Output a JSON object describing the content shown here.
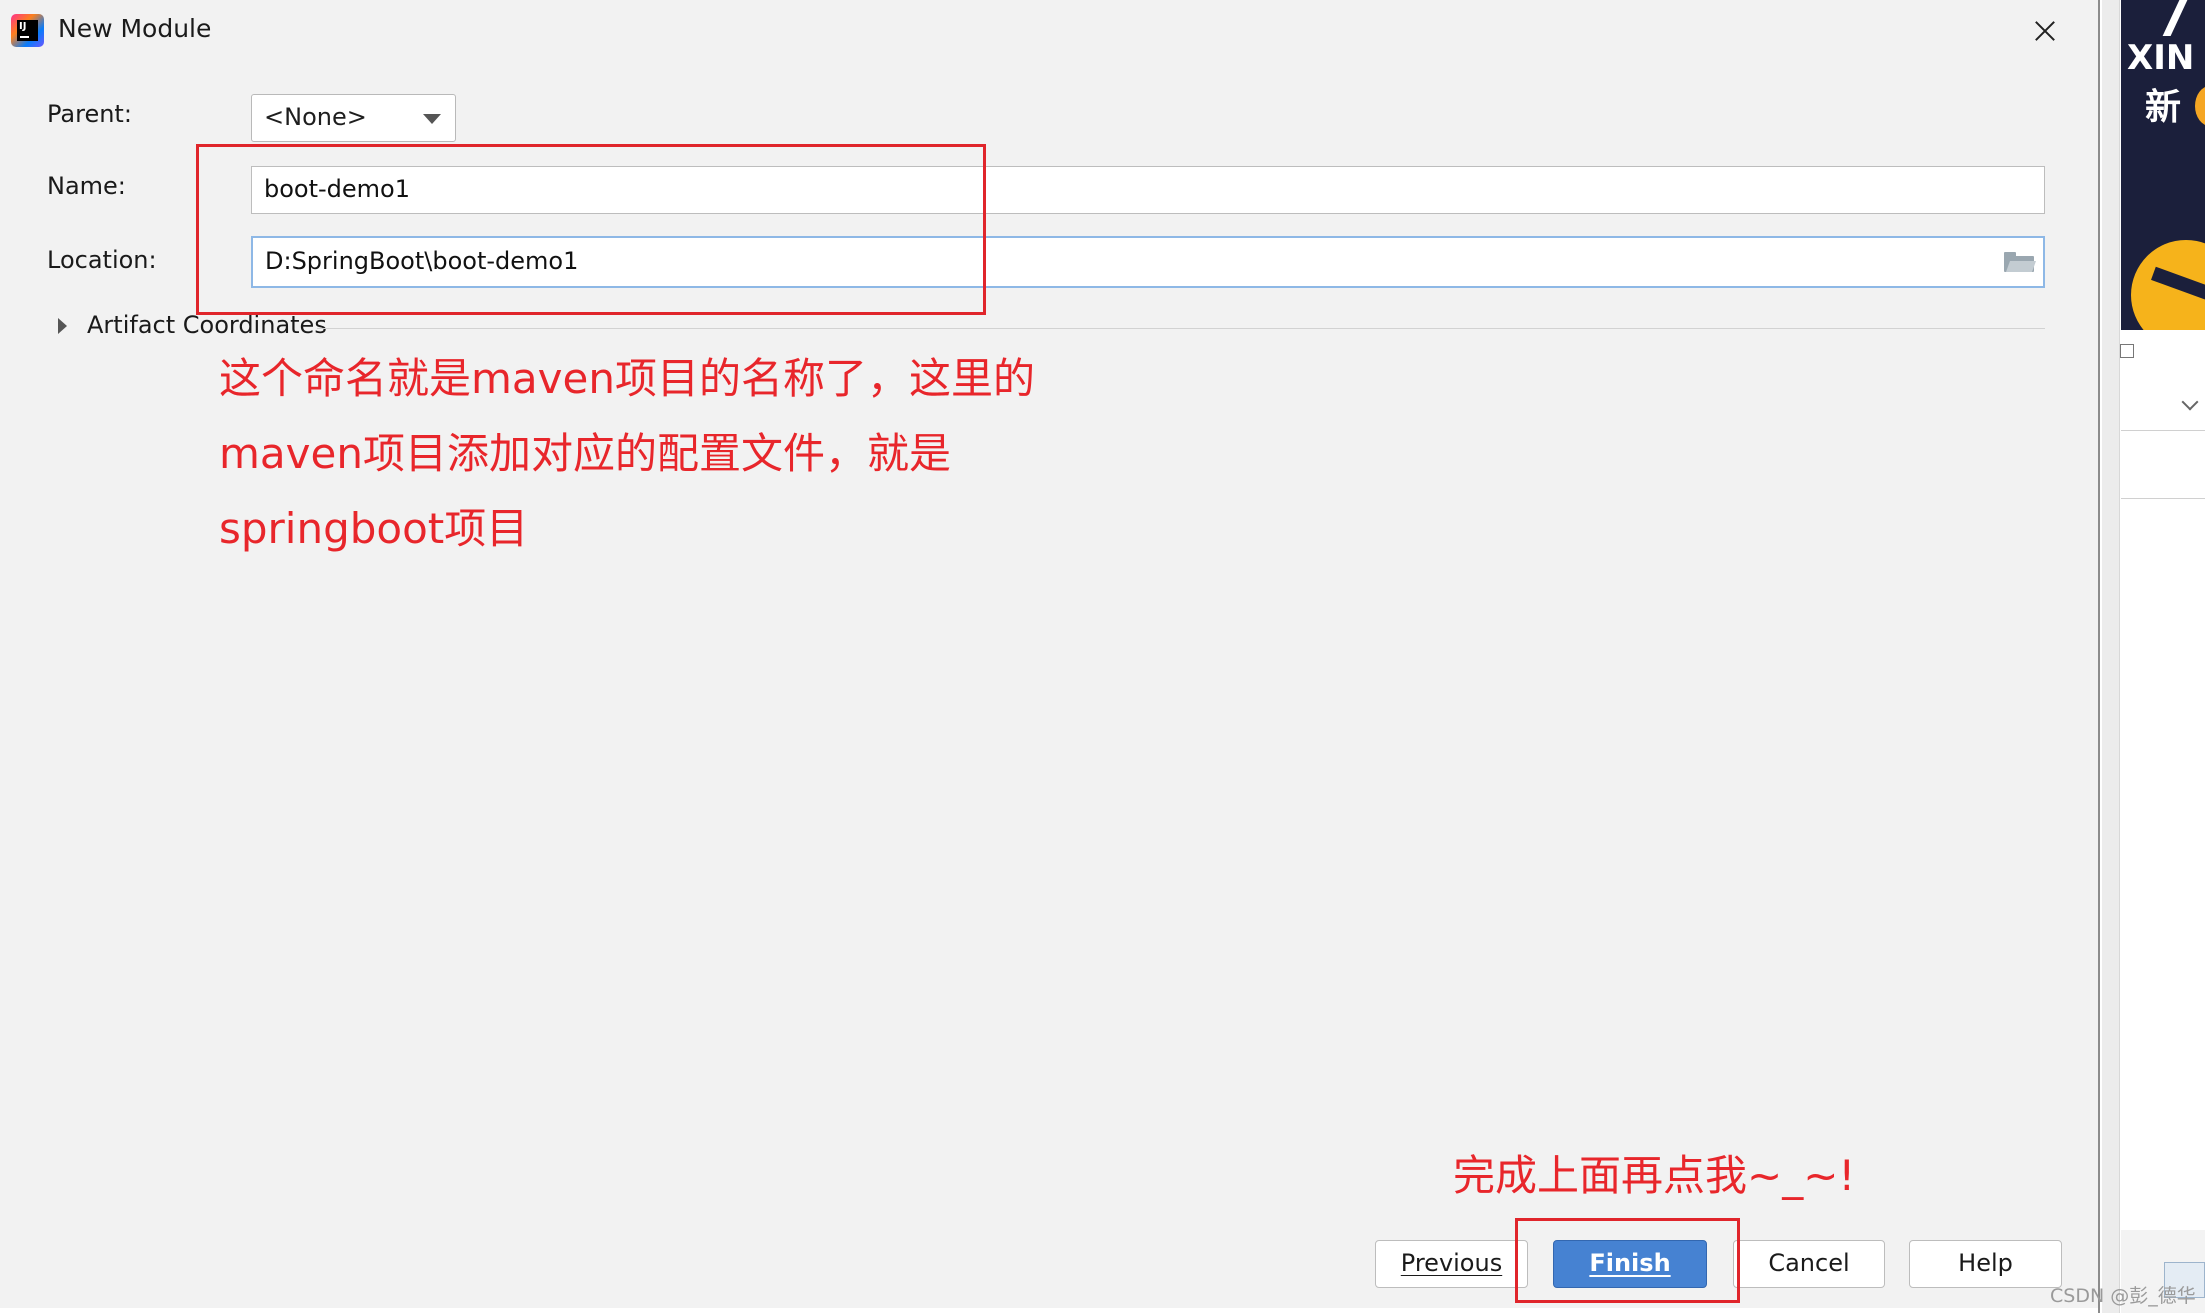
{
  "dialog": {
    "title": "New Module",
    "fields": {
      "parent_label": "Parent:",
      "parent_value": "<None>",
      "name_label": "Name:",
      "name_value": "boot-demo1",
      "location_label": "Location:",
      "location_value": "D:SpringBoot\\boot-demo1"
    },
    "artifact_coordinates_label": "Artifact Coordinates",
    "buttons": {
      "previous": "Previous",
      "finish": "Finish",
      "cancel": "Cancel",
      "help": "Help"
    }
  },
  "annotations": {
    "lines": [
      "这个命名就是maven项目的名称了，这里的",
      "maven项目添加对应的配置文件，就是",
      "springboot项目"
    ],
    "finish_hint": "完成上面再点我~_~!",
    "color": "#e8262b"
  },
  "background_app": {
    "ad_text_1": "XIN",
    "ad_text_2": "新"
  },
  "watermark": "CSDN @彭_德华",
  "colors": {
    "finish_button": "#4682d2",
    "focus_border": "#8eb8e6",
    "highlight_box": "#e0252b"
  },
  "icons": [
    "intellij-app-icon",
    "close-icon",
    "dropdown-arrow-icon",
    "folder-icon",
    "expand-triangle-icon"
  ]
}
